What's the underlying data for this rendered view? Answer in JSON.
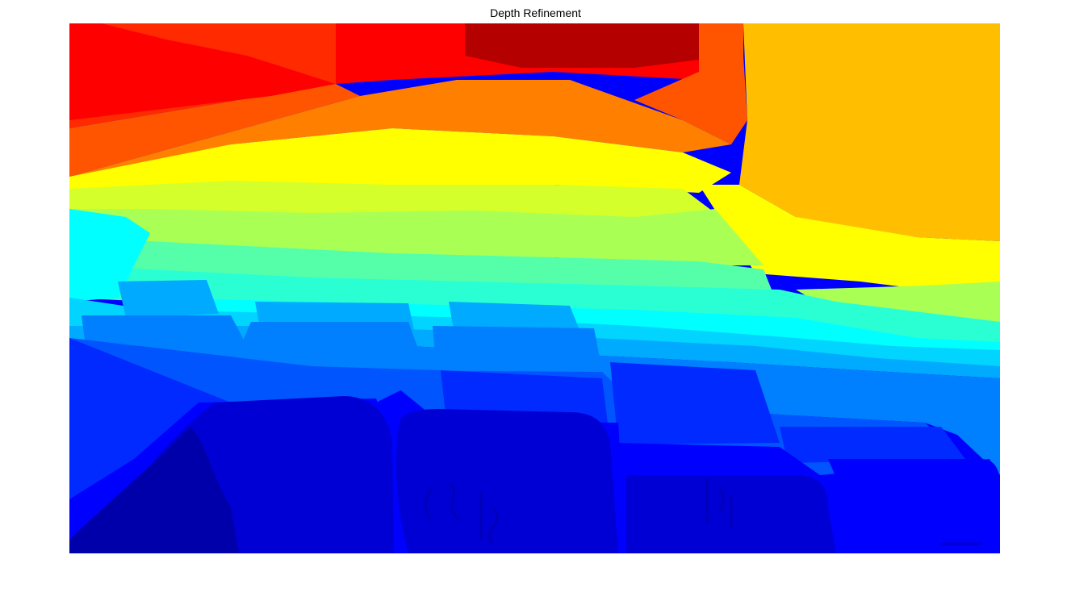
{
  "figure": {
    "title": "Depth Refinement"
  },
  "image": {
    "description_colormap": "jet",
    "colors": {
      "dark_red": "#B50000",
      "red": "#FF0000",
      "red_orange": "#FF2A00",
      "orange_red": "#FF5500",
      "orange": "#FF7F00",
      "amber": "#FFBF00",
      "yellow": "#FFFF00",
      "lime": "#D4FF2A",
      "light_green": "#AAFF55",
      "green": "#55FFAA",
      "aqua": "#2AFFD4",
      "cyan": "#00FFFF",
      "sky": "#00D4FF",
      "light_blue": "#00AAFF",
      "azure": "#007FFF",
      "blue": "#0055FF",
      "bright_blue": "#002AFF",
      "pure_blue": "#0000FF",
      "medium_blue": "#0000D4",
      "dark_blue": "#0000AA"
    }
  }
}
